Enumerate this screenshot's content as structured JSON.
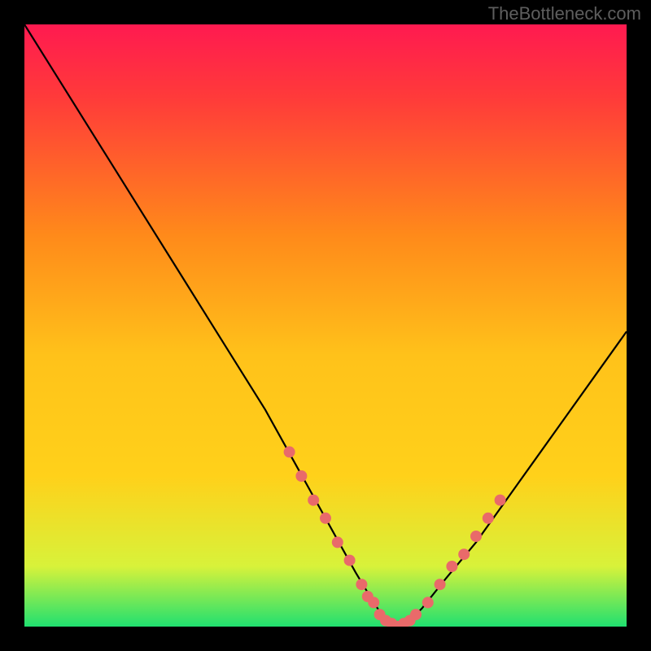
{
  "watermark": "TheBottleneck.com",
  "chart_data": {
    "type": "line",
    "title": "",
    "xlabel": "",
    "ylabel": "",
    "xlim": [
      0,
      100
    ],
    "ylim": [
      0,
      100
    ],
    "background_gradient": {
      "top": "#ff1a50",
      "mid": "#ffd11a",
      "bottom": "#20e070"
    },
    "curve": {
      "description": "V-shaped bottleneck curve, minimum near x≈62, left arm steep from top, right arm moderate slope",
      "x": [
        0,
        5,
        10,
        15,
        20,
        25,
        30,
        35,
        40,
        45,
        50,
        55,
        58,
        60,
        62,
        64,
        66,
        70,
        75,
        80,
        85,
        90,
        95,
        100
      ],
      "y": [
        100,
        92,
        84,
        76,
        68,
        60,
        52,
        44,
        36,
        27,
        18,
        9,
        4,
        1,
        0,
        1,
        3,
        8,
        14,
        21,
        28,
        35,
        42,
        49
      ]
    },
    "markers": {
      "description": "salmon-colored dots clustered on both arms near and at the valley",
      "color": "#e96a6a",
      "points_xy": [
        [
          44,
          29
        ],
        [
          46,
          25
        ],
        [
          48,
          21
        ],
        [
          50,
          18
        ],
        [
          52,
          14
        ],
        [
          54,
          11
        ],
        [
          56,
          7
        ],
        [
          57,
          5
        ],
        [
          58,
          4
        ],
        [
          59,
          2
        ],
        [
          60,
          1
        ],
        [
          61,
          0.5
        ],
        [
          62,
          0
        ],
        [
          63,
          0.5
        ],
        [
          64,
          1
        ],
        [
          65,
          2
        ],
        [
          67,
          4
        ],
        [
          69,
          7
        ],
        [
          71,
          10
        ],
        [
          73,
          12
        ],
        [
          75,
          15
        ],
        [
          77,
          18
        ],
        [
          79,
          21
        ]
      ]
    }
  }
}
